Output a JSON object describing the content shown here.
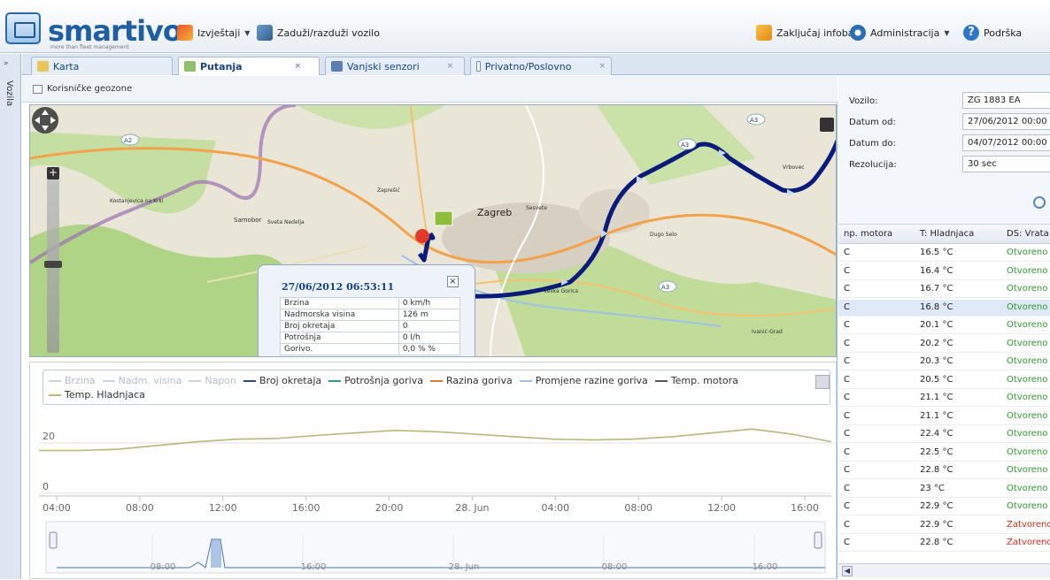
{
  "app": {
    "brand": "smartivo",
    "tagline": "more than fleet management"
  },
  "toolbar": {
    "reports_label": "Izvještaji",
    "assign_vehicle_label": "Zaduži/razduži vozilo",
    "lock_infobar_label": "Zaključaj infobar",
    "admin_label": "Administracija",
    "support_label": "Podrška"
  },
  "leftstrip": {
    "collapse_glyph": "»",
    "vertical_label": "Vozila"
  },
  "tabs": [
    {
      "label": "Karta"
    },
    {
      "label": "Putanja"
    },
    {
      "label": "Vanjski senzori"
    },
    {
      "label": "Privatno/Poslovno"
    }
  ],
  "geozones_label": "Korisničke geozone",
  "map": {
    "city_label": "Zagreb",
    "places": [
      "Samobor",
      "Sveta Nedelja",
      "Zaprešić",
      "Sesvete",
      "Velika Gorica",
      "Dugo Selo",
      "Kostanjevica na Krki",
      "Vrbovec",
      "Ivanić-Grad"
    ],
    "road_labels": [
      "A2",
      "A3",
      "A3",
      "A3"
    ]
  },
  "popup": {
    "title": "27/06/2012 06:53:11",
    "rows": [
      {
        "k": "Brzina",
        "v": "0 km/h"
      },
      {
        "k": "Nadmorska visina",
        "v": "126 m"
      },
      {
        "k": "Broj okretaja",
        "v": "0"
      },
      {
        "k": "Potrošnja",
        "v": "0 l/h"
      },
      {
        "k": "Gorivo.",
        "v": "0,0 % %"
      }
    ]
  },
  "legend": [
    {
      "name": "Brzina",
      "enabled": false,
      "color": "#c9d2de"
    },
    {
      "name": "Nadm. visina",
      "enabled": false,
      "color": "#c9d2de"
    },
    {
      "name": "Napon",
      "enabled": false,
      "color": "#c9d2de"
    },
    {
      "name": "Broj okretaja",
      "enabled": true,
      "color": "#2d4a78"
    },
    {
      "name": "Potrošnja goriva",
      "enabled": true,
      "color": "#2a9d8f"
    },
    {
      "name": "Razina goriva",
      "enabled": true,
      "color": "#e07b2c"
    },
    {
      "name": "Promjene razine goriva",
      "enabled": true,
      "color": "#9dc3e6"
    },
    {
      "name": "Temp. motora",
      "enabled": true,
      "color": "#555555"
    },
    {
      "name": "Temp. Hladnjaca",
      "enabled": true,
      "color": "#b7b87c"
    }
  ],
  "chart_data": {
    "type": "line",
    "y_ticks": [
      "20",
      "0"
    ],
    "ylim": [
      0,
      35
    ],
    "x_ticks": [
      "04:00",
      "08:00",
      "12:00",
      "16:00",
      "20:00",
      "28. Jun",
      "04:00",
      "08:00",
      "12:00",
      "16:00"
    ],
    "navigator_ticks": [
      "08:00",
      "16:00",
      "28. Jun",
      "08:00",
      "16:00"
    ],
    "series": [
      {
        "name": "Temp. Hladnjaca",
        "color": "#b7b87c",
        "x": [
          0,
          1,
          2,
          3,
          4,
          5,
          6,
          7,
          8,
          9,
          10,
          11,
          12,
          13,
          14,
          15,
          16,
          17,
          18,
          19,
          20
        ],
        "values": [
          17.0,
          17.0,
          17.5,
          19.0,
          20.5,
          21.5,
          21.8,
          23.0,
          24.0,
          25.0,
          24.5,
          23.5,
          22.5,
          21.5,
          21.2,
          21.5,
          22.5,
          24.0,
          25.5,
          23.5,
          20.5
        ]
      }
    ]
  },
  "form": {
    "vehicle_label": "Vozilo:",
    "vehicle_value": "ZG 1883 EA",
    "date_from_label": "Datum od:",
    "date_from_value": "27/06/2012 00:00",
    "date_to_label": "Datum do:",
    "date_to_value": "04/07/2012 00:00",
    "resolution_label": "Rezolucija:",
    "resolution_value": "30 sec"
  },
  "grid": {
    "headers": [
      "np. motora",
      "T: Hladnjaca",
      "DS: Vrata"
    ],
    "rows": [
      {
        "c1": "C",
        "c2": "16.5 °C",
        "c3": "Otvoreno",
        "status": "open"
      },
      {
        "c1": "C",
        "c2": "16.4 °C",
        "c3": "Otvoreno",
        "status": "open"
      },
      {
        "c1": "C",
        "c2": "16.7 °C",
        "c3": "Otvoreno",
        "status": "open"
      },
      {
        "c1": "C",
        "c2": "16.8 °C",
        "c3": "Otvoreno",
        "status": "open"
      },
      {
        "c1": "C",
        "c2": "20.1 °C",
        "c3": "Otvoreno",
        "status": "open"
      },
      {
        "c1": "C",
        "c2": "20.2 °C",
        "c3": "Otvoreno",
        "status": "open"
      },
      {
        "c1": "C",
        "c2": "20.3 °C",
        "c3": "Otvoreno",
        "status": "open"
      },
      {
        "c1": "C",
        "c2": "20.5 °C",
        "c3": "Otvoreno",
        "status": "open"
      },
      {
        "c1": "C",
        "c2": "21.1 °C",
        "c3": "Otvoreno",
        "status": "open"
      },
      {
        "c1": "C",
        "c2": "21.1 °C",
        "c3": "Otvoreno",
        "status": "open"
      },
      {
        "c1": "C",
        "c2": "22.4 °C",
        "c3": "Otvoreno",
        "status": "open"
      },
      {
        "c1": "C",
        "c2": "22.5 °C",
        "c3": "Otvoreno",
        "status": "open"
      },
      {
        "c1": "C",
        "c2": "22.8 °C",
        "c3": "Otvoreno",
        "status": "open"
      },
      {
        "c1": "C",
        "c2": "23 °C",
        "c3": "Otvoreno",
        "status": "open"
      },
      {
        "c1": "C",
        "c2": "22.9 °C",
        "c3": "Otvoreno",
        "status": "open"
      },
      {
        "c1": "C",
        "c2": "22.9 °C",
        "c3": "Zatvoreno",
        "status": "closed"
      },
      {
        "c1": "C",
        "c2": "22.8 °C",
        "c3": "Zatvoreno",
        "status": "closed"
      }
    ]
  }
}
